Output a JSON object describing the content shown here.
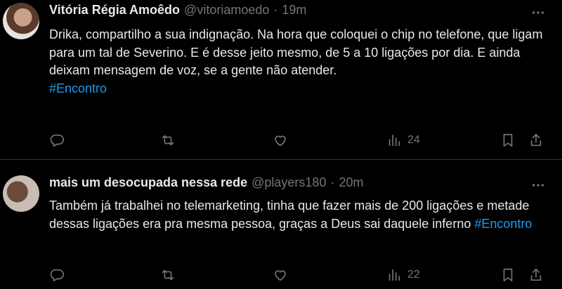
{
  "tweets": [
    {
      "name": "Vitória Régia Amoêdo",
      "handle": "@vitoriamoedo",
      "separator": "·",
      "time": "19m",
      "text": "Drika, compartilho a sua indignação. Na hora que coloquei o chip no telefone, que ligam para um tal de Severino. E é desse jeito mesmo, de 5 a 10 ligações por dia. E ainda deixam mensagem de voz, se a gente não atender.",
      "hashtag": "#Encontro",
      "views": "24"
    },
    {
      "name": "mais um desocupada nessa rede",
      "handle": "@players180",
      "separator": "·",
      "time": "20m",
      "text": "Também já trabalhei no telemarketing, tinha que fazer mais de 200 ligações e metade dessas ligações era pra mesma pessoa, graças a Deus sai daquele inferno ",
      "hashtag": "#Encontro",
      "views": "22"
    }
  ],
  "icons": {
    "more": "more-horizontal-icon",
    "reply": "reply-icon",
    "retweet": "retweet-icon",
    "like": "heart-icon",
    "views": "views-icon",
    "bookmark": "bookmark-icon",
    "share": "share-icon"
  },
  "colors": {
    "background": "#000000",
    "text": "#e7e9ea",
    "muted": "#71767b",
    "link": "#1d9bf0",
    "divider": "#2f3336"
  }
}
